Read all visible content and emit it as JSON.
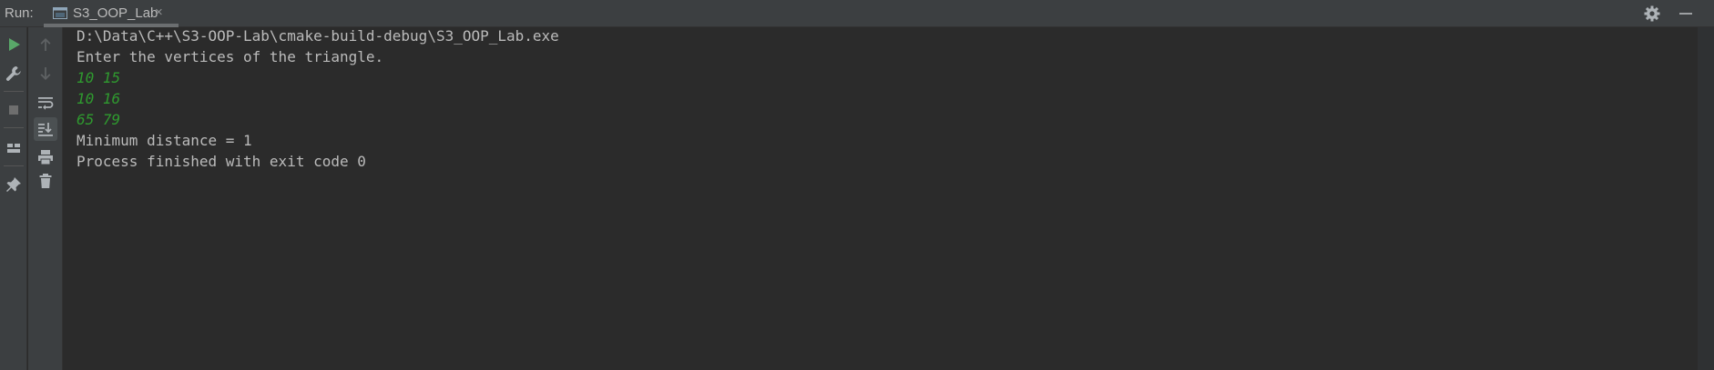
{
  "header": {
    "run_label": "Run:",
    "tab_label": "S3_OOP_Lab",
    "close_glyph": "×",
    "settings_icon": "gear-icon",
    "minimize_icon": "minimize-icon"
  },
  "left_toolbar": [
    {
      "name": "rerun-icon",
      "color": "#59a869"
    },
    {
      "name": "wrench-icon",
      "color": "#aeb3b7"
    },
    {
      "name": "stop-icon",
      "color": "#6e6e6e"
    },
    {
      "name": "layout-icon",
      "color": "#aeb3b7"
    },
    {
      "name": "pin-icon",
      "color": "#aeb3b7"
    }
  ],
  "console_toolbar": [
    {
      "name": "up-arrow-icon"
    },
    {
      "name": "down-arrow-icon"
    },
    {
      "name": "soft-wrap-icon"
    },
    {
      "name": "scroll-to-end-icon"
    },
    {
      "name": "print-icon"
    },
    {
      "name": "trash-icon"
    }
  ],
  "console": {
    "lines": [
      {
        "text": "D:\\Data\\C++\\S3-OOP-Lab\\cmake-build-debug\\S3_OOP_Lab.exe",
        "kind": "output"
      },
      {
        "text": "Enter the vertices of the triangle.",
        "kind": "output"
      },
      {
        "text": "10 15",
        "kind": "input"
      },
      {
        "text": "10 16",
        "kind": "input"
      },
      {
        "text": "65 79",
        "kind": "input"
      },
      {
        "text": "Minimum distance = 1",
        "kind": "output"
      },
      {
        "text": "Process finished with exit code 0",
        "kind": "output"
      }
    ]
  },
  "colors": {
    "background": "#2b2b2b",
    "panel": "#3c3f41",
    "text": "#bbbbbb",
    "user_input": "#2f9a2f",
    "run_green": "#59a869"
  }
}
